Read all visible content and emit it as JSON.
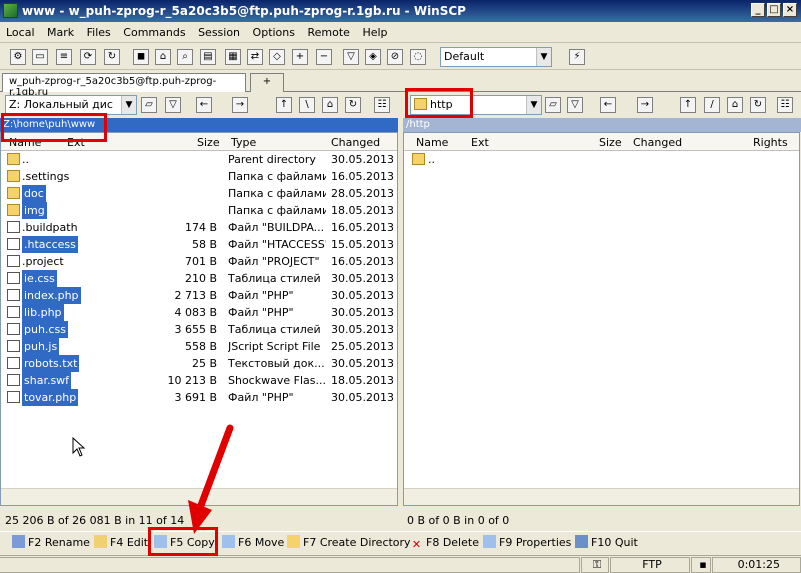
{
  "window": {
    "title": "www - w_puh-zprog-r_5a20c3b5@ftp.puh-zprog-r.1gb.ru - WinSCP"
  },
  "menu": [
    "Local",
    "Mark",
    "Files",
    "Commands",
    "Session",
    "Options",
    "Remote",
    "Help"
  ],
  "toolbar": {
    "profile": "Default"
  },
  "tabs": {
    "session": "w_puh-zprog-r_5a20c3b5@ftp.puh-zprog-r.1gb.ru",
    "new_tab": "+"
  },
  "left": {
    "drive": "Z: Локальный дис",
    "path": "Z:\\home\\puh\\www",
    "columns": {
      "name": "Name",
      "ext": "Ext",
      "size": "Size",
      "type": "Type",
      "changed": "Changed"
    },
    "files": [
      {
        "name": "..",
        "size": "",
        "type": "Parent directory",
        "changed": "30.05.2013",
        "kind": "up",
        "selected": false
      },
      {
        "name": ".settings",
        "size": "",
        "type": "Папка с файлами",
        "changed": "16.05.2013",
        "kind": "folder",
        "selected": false
      },
      {
        "name": "doc",
        "size": "",
        "type": "Папка с файлами",
        "changed": "28.05.2013",
        "kind": "folder",
        "selected": true
      },
      {
        "name": "img",
        "size": "",
        "type": "Папка с файлами",
        "changed": "18.05.2013",
        "kind": "folder",
        "selected": true
      },
      {
        "name": ".buildpath",
        "size": "174 B",
        "type": "Файл \"BUILDPA...",
        "changed": "16.05.2013",
        "kind": "file",
        "selected": false
      },
      {
        "name": ".htaccess",
        "size": "58 B",
        "type": "Файл \"HTACCESS\"",
        "changed": "15.05.2013",
        "kind": "file",
        "selected": true
      },
      {
        "name": ".project",
        "size": "701 B",
        "type": "Файл \"PROJECT\"",
        "changed": "16.05.2013",
        "kind": "file",
        "selected": false
      },
      {
        "name": "ie.css",
        "size": "210 B",
        "type": "Таблица стилей",
        "changed": "30.05.2013",
        "kind": "file",
        "selected": true
      },
      {
        "name": "index.php",
        "size": "2 713 B",
        "type": "Файл \"PHP\"",
        "changed": "30.05.2013",
        "kind": "file",
        "selected": true
      },
      {
        "name": "lib.php",
        "size": "4 083 B",
        "type": "Файл \"PHP\"",
        "changed": "30.05.2013",
        "kind": "file",
        "selected": true
      },
      {
        "name": "puh.css",
        "size": "3 655 B",
        "type": "Таблица стилей",
        "changed": "30.05.2013",
        "kind": "file",
        "selected": true
      },
      {
        "name": "puh.js",
        "size": "558 B",
        "type": "JScript Script File",
        "changed": "25.05.2013",
        "kind": "file",
        "selected": true
      },
      {
        "name": "robots.txt",
        "size": "25 B",
        "type": "Текстовый док...",
        "changed": "30.05.2013",
        "kind": "file",
        "selected": true
      },
      {
        "name": "shar.swf",
        "size": "10 213 B",
        "type": "Shockwave Flas...",
        "changed": "18.05.2013",
        "kind": "file",
        "selected": true
      },
      {
        "name": "tovar.php",
        "size": "3 691 B",
        "type": "Файл \"PHP\"",
        "changed": "30.05.2013",
        "kind": "file",
        "selected": true
      }
    ],
    "status": "25 206 B of 26 081 B in 11 of 14"
  },
  "right": {
    "folder": "http",
    "path": "/http",
    "columns": {
      "name": "Name",
      "ext": "Ext",
      "size": "Size",
      "changed": "Changed",
      "rights": "Rights"
    },
    "files": [
      {
        "name": "..",
        "kind": "up"
      }
    ],
    "status": "0 B of 0 B in 0 of 0"
  },
  "fn_keys": [
    {
      "label": "F2 Rename",
      "icon": "rename-icon"
    },
    {
      "label": "F4 Edit",
      "icon": "edit-icon"
    },
    {
      "label": "F5 Copy",
      "icon": "copy-icon"
    },
    {
      "label": "F6 Move",
      "icon": "move-icon"
    },
    {
      "label": "F7 Create Directory",
      "icon": "create-directory-icon"
    },
    {
      "label": "F8 Delete",
      "icon": "delete-icon"
    },
    {
      "label": "F9 Properties",
      "icon": "properties-icon"
    },
    {
      "label": "F10 Quit",
      "icon": "quit-icon"
    }
  ],
  "statusbar": {
    "protocol": "FTP",
    "time": "0:01:25"
  }
}
